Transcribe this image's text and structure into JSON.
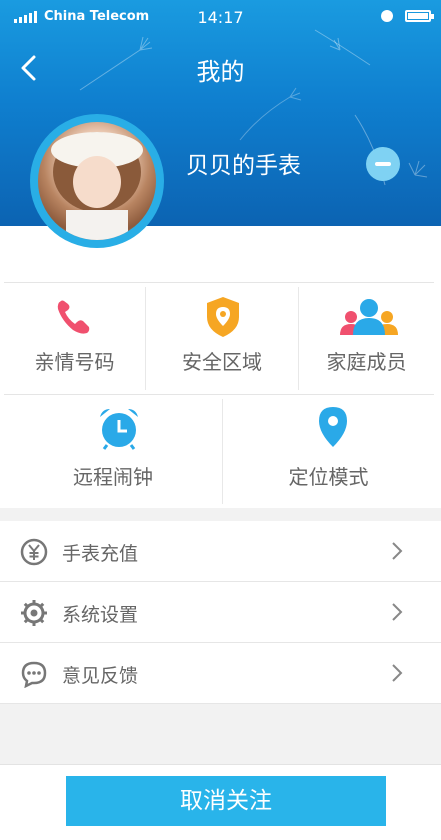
{
  "status_bar": {
    "carrier": "China Telecom",
    "time": "14:17"
  },
  "header": {
    "title": "我的",
    "device_name": "贝贝的手表"
  },
  "features": [
    {
      "label": "亲情号码",
      "icon": "phone-icon",
      "color": "#f0506e"
    },
    {
      "label": "安全区域",
      "icon": "shield-icon",
      "color": "#f6a623"
    },
    {
      "label": "家庭成员",
      "icon": "family-icon",
      "color": "#2aa9e8"
    },
    {
      "label": "远程闹钟",
      "icon": "alarm-clock-icon",
      "color": "#2aa9e8"
    },
    {
      "label": "定位模式",
      "icon": "location-pin-icon",
      "color": "#2aa9e8"
    }
  ],
  "menu": [
    {
      "label": "手表充值",
      "icon": "yuan-icon"
    },
    {
      "label": "系统设置",
      "icon": "gear-icon"
    },
    {
      "label": "意见反馈",
      "icon": "chat-icon"
    }
  ],
  "button": {
    "label": "取消关注"
  },
  "colors": {
    "accent": "#29b4ea",
    "header_top": "#1a9be0",
    "header_bottom": "#0c63b2"
  }
}
